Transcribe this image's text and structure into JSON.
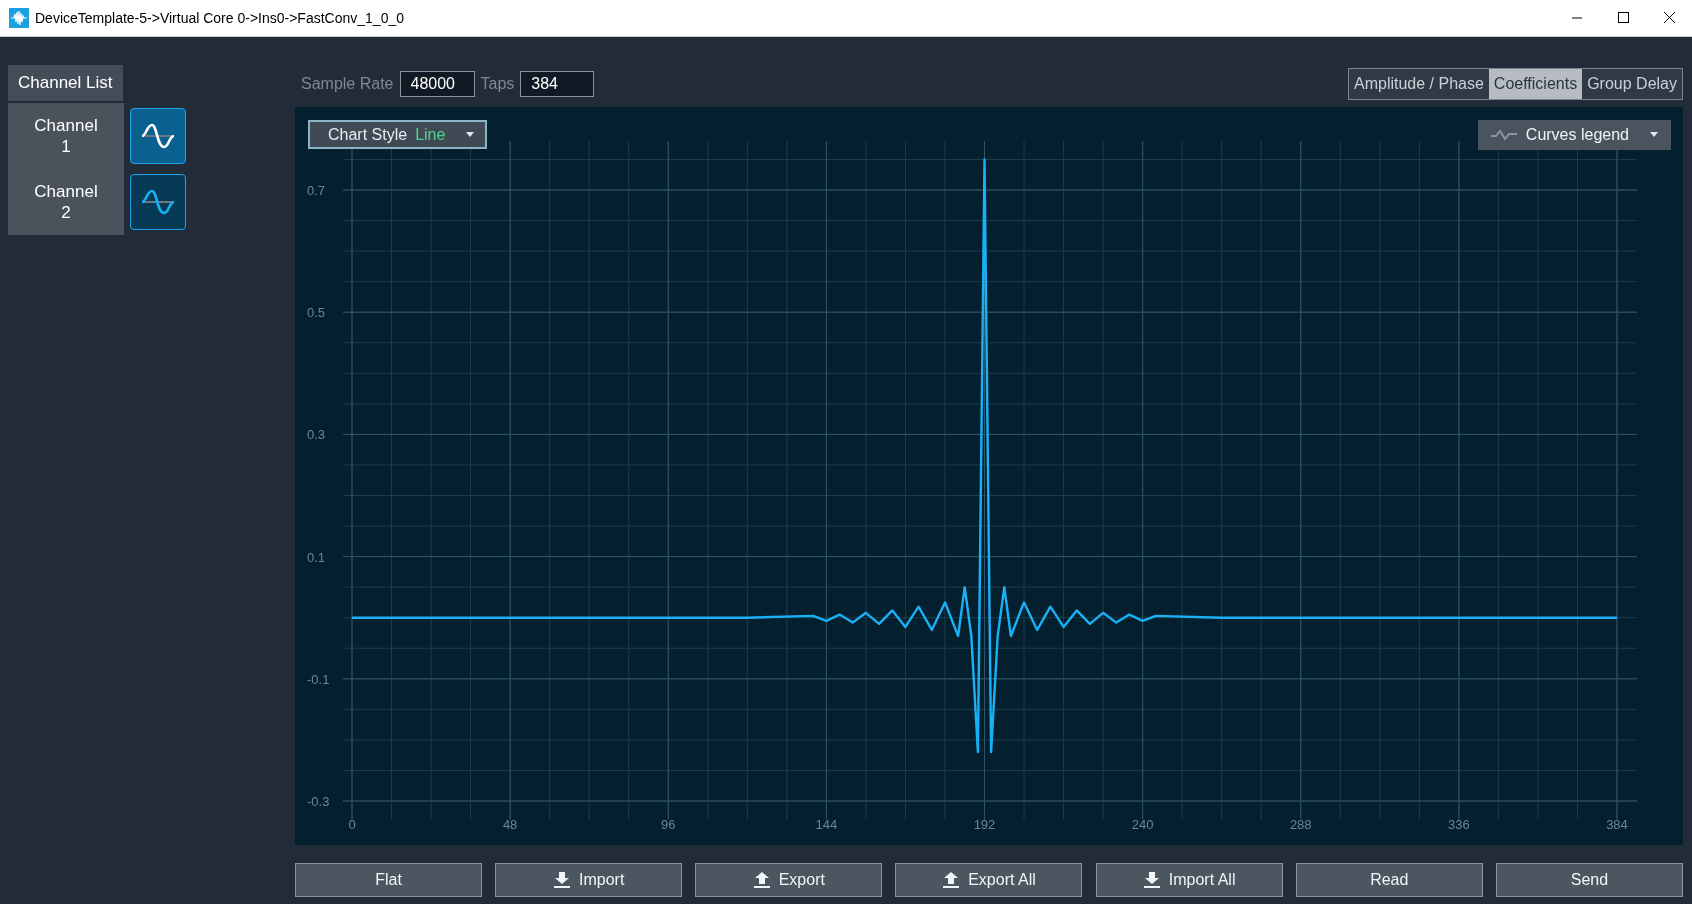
{
  "window": {
    "title": "DeviceTemplate-5->Virtual Core 0->Ins0->FastConv_1_0_0"
  },
  "channel_list": {
    "title": "Channel List",
    "channels": [
      {
        "label": "Channel 1",
        "selected": true
      },
      {
        "label": "Channel 2",
        "selected": false
      }
    ]
  },
  "sample_rate": {
    "label": "Sample Rate",
    "value": "48000"
  },
  "taps": {
    "label": "Taps",
    "value": "384"
  },
  "view_tabs": [
    {
      "label": "Amplitude / Phase",
      "selected": false
    },
    {
      "label": "Coefficients",
      "selected": true
    },
    {
      "label": "Group Delay",
      "selected": false
    }
  ],
  "chart": {
    "chart_style": {
      "label": "Chart Style",
      "value": "Line"
    },
    "curves_legend": "Curves legend",
    "chart_data": {
      "type": "line",
      "x": [
        0,
        48,
        96,
        120,
        140,
        144,
        148,
        152,
        156,
        160,
        164,
        168,
        172,
        176,
        180,
        184,
        186,
        188,
        190,
        192,
        194,
        196,
        198,
        200,
        204,
        208,
        212,
        216,
        220,
        224,
        228,
        232,
        236,
        240,
        244,
        264,
        288,
        336,
        384
      ],
      "series": [
        {
          "color": "#1ab0f5",
          "values": [
            0,
            0,
            0,
            0,
            0.003,
            -0.005,
            0.005,
            -0.008,
            0.008,
            -0.01,
            0.012,
            -0.015,
            0.018,
            -0.02,
            0.025,
            -0.03,
            0.05,
            -0.03,
            -0.22,
            0.75,
            -0.22,
            -0.03,
            0.05,
            -0.03,
            0.025,
            -0.02,
            0.018,
            -0.015,
            0.012,
            -0.01,
            0.008,
            -0.008,
            0.005,
            -0.005,
            0.003,
            0,
            0,
            0,
            0
          ]
        }
      ],
      "xlim": [
        0,
        384
      ],
      "ylim": [
        -0.33,
        0.78
      ],
      "xticks": [
        0,
        48,
        96,
        144,
        192,
        240,
        288,
        336,
        384
      ],
      "yticks": [
        -0.3,
        -0.1,
        0.1,
        0.3,
        0.5,
        0.7
      ],
      "grid": true
    }
  },
  "buttons": [
    {
      "label": "Flat",
      "kind": "plain"
    },
    {
      "label": "Import",
      "kind": "import"
    },
    {
      "label": "Export",
      "kind": "export"
    },
    {
      "label": "Export All",
      "kind": "export"
    },
    {
      "label": "Import All",
      "kind": "import"
    },
    {
      "label": "Read",
      "kind": "plain"
    },
    {
      "label": "Send",
      "kind": "plain"
    }
  ]
}
